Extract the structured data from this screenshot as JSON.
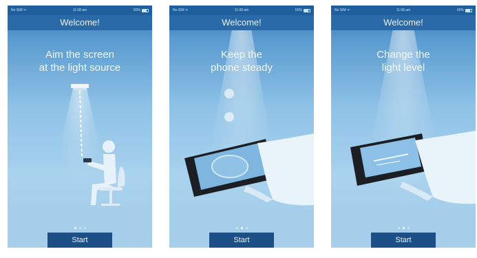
{
  "status_bar": {
    "carrier": "No SIM ᯤ",
    "time": "11:08 am",
    "battery": "60%"
  },
  "screens": [
    {
      "title": "Welcome!",
      "instruction": "Aim the screen\nat the light source",
      "start_label": "Start",
      "active_page": 1,
      "page_count": 3
    },
    {
      "title": "Welcome!",
      "instruction": "Keep the\nphone steady",
      "start_label": "Start",
      "active_page": 2,
      "page_count": 3
    },
    {
      "title": "Welcome!",
      "instruction": "Change the\nlight level",
      "start_label": "Start",
      "active_page": 2,
      "page_count": 3
    }
  ],
  "icons": [
    "lamp-icon",
    "person-seated-icon",
    "chair-icon",
    "hand-holding-phone-icon",
    "light-orb-icon",
    "light-level-slider-icon"
  ]
}
